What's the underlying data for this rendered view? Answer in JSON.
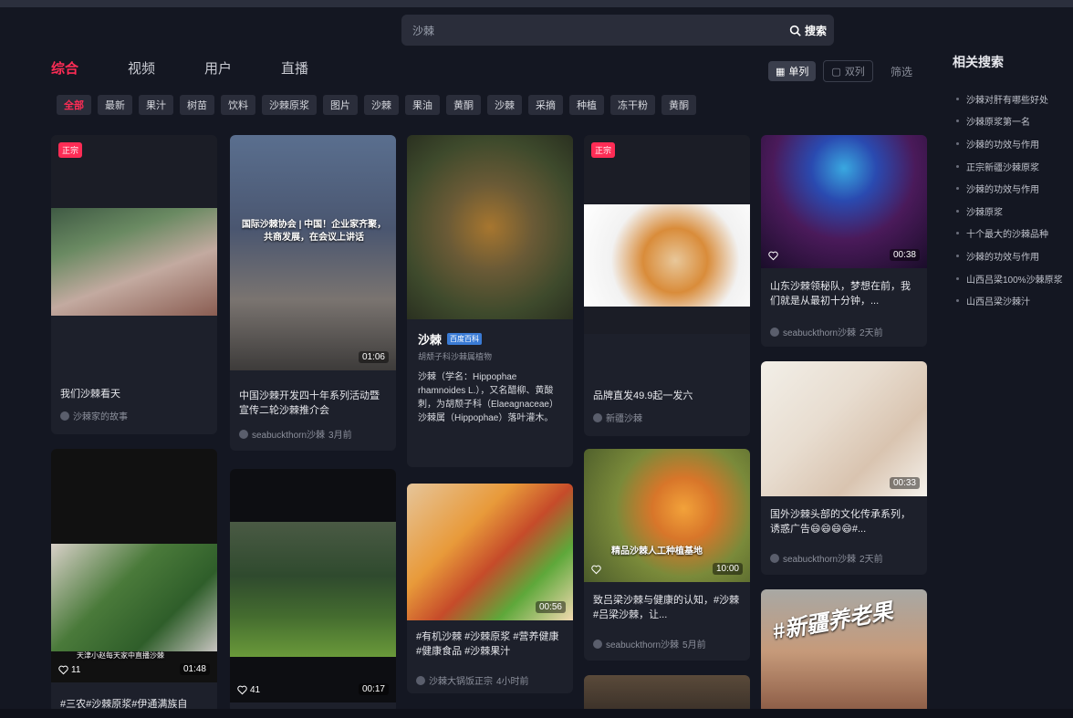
{
  "search": {
    "query": "沙棘",
    "button_label": "搜索"
  },
  "tabs": [
    {
      "label": "综合",
      "active": true
    },
    {
      "label": "视频",
      "active": false
    },
    {
      "label": "用户",
      "active": false
    },
    {
      "label": "直播",
      "active": false
    }
  ],
  "view": {
    "grid_label": "单列",
    "list_label": "双列",
    "filter_label": "筛选"
  },
  "chips": [
    "全部",
    "最新",
    "果汁",
    "树苗",
    "饮料",
    "沙棘原浆",
    "图片",
    "沙棘",
    "果油",
    "黄酮",
    "沙棘",
    "采摘",
    "种植",
    "冻干粉",
    "黄酮"
  ],
  "related": {
    "title": "相关搜索",
    "items": [
      "沙棘对肝有哪些好处",
      "沙棘原浆第一名",
      "沙棘的功效与作用",
      "正宗新疆沙棘原浆",
      "沙棘的功效与作用",
      "沙棘原浆",
      "十个最大的沙棘品种",
      "沙棘的功效与作用",
      "山西吕梁100%沙棘原浆",
      "山西吕梁沙棘汁"
    ]
  },
  "cards": [
    {
      "title": "我们沙棘看天",
      "author": "沙棘家的故事",
      "badge": "正宗",
      "likes": "",
      "duration": ""
    },
    {
      "title": "中国沙棘开发四十年系列活动暨宣传二轮沙棘推介会",
      "author": "seabuckthorn沙棘",
      "time": "3月前",
      "overlay": "国际沙棘协会 | 中国！企业家齐聚，共商发展，在会议上讲话",
      "duration": "01:06"
    },
    {
      "title": "沙棘",
      "tag": "百度百科",
      "subtitle": "胡颓子科沙棘属植物",
      "desc": "沙棘（学名：Hippophae rhamnoides L.），又名醋柳、黄酸刺，为胡颓子科（Elaeagnaceae）沙棘属（Hippophae）落叶灌木。"
    },
    {
      "title": "品牌直发49.9起一发六",
      "author": "新疆沙棘",
      "badge": "正宗"
    },
    {
      "title": "山东沙棘领秘队，梦想在前，我们就是从最初十分钟，...",
      "author": "seabuckthorn沙棘",
      "time": "2天前",
      "likes": "",
      "duration": "00:38"
    },
    {
      "title": "#三农#沙棘原浆#伊通满族自",
      "likes": "11",
      "duration": "01:48",
      "overlay": "天津小赵每天家中直播沙棘"
    },
    {
      "title": "",
      "likes": "41",
      "duration": "00:17"
    },
    {
      "title": "#有机沙棘 #沙棘原浆 #营养健康 #健康食品 #沙棘果汁",
      "author": "沙棘大锅饭正宗",
      "time": "4小时前",
      "duration": "00:56"
    },
    {
      "title": "致吕梁沙棘与健康的认知，#沙棘 #吕梁沙棘，让...",
      "author": "seabuckthorn沙棘",
      "time": "5月前",
      "likes": "",
      "duration": "10:00",
      "overlay": "精品沙棘人工种植基地"
    },
    {
      "title": "国外沙棘头部的文化传承系列，诱惑广告😄😄😄😄#...",
      "author": "seabuckthorn沙棘",
      "time": "2天前",
      "duration": "00:33"
    },
    {
      "overlay": "#新疆养老果"
    }
  ]
}
